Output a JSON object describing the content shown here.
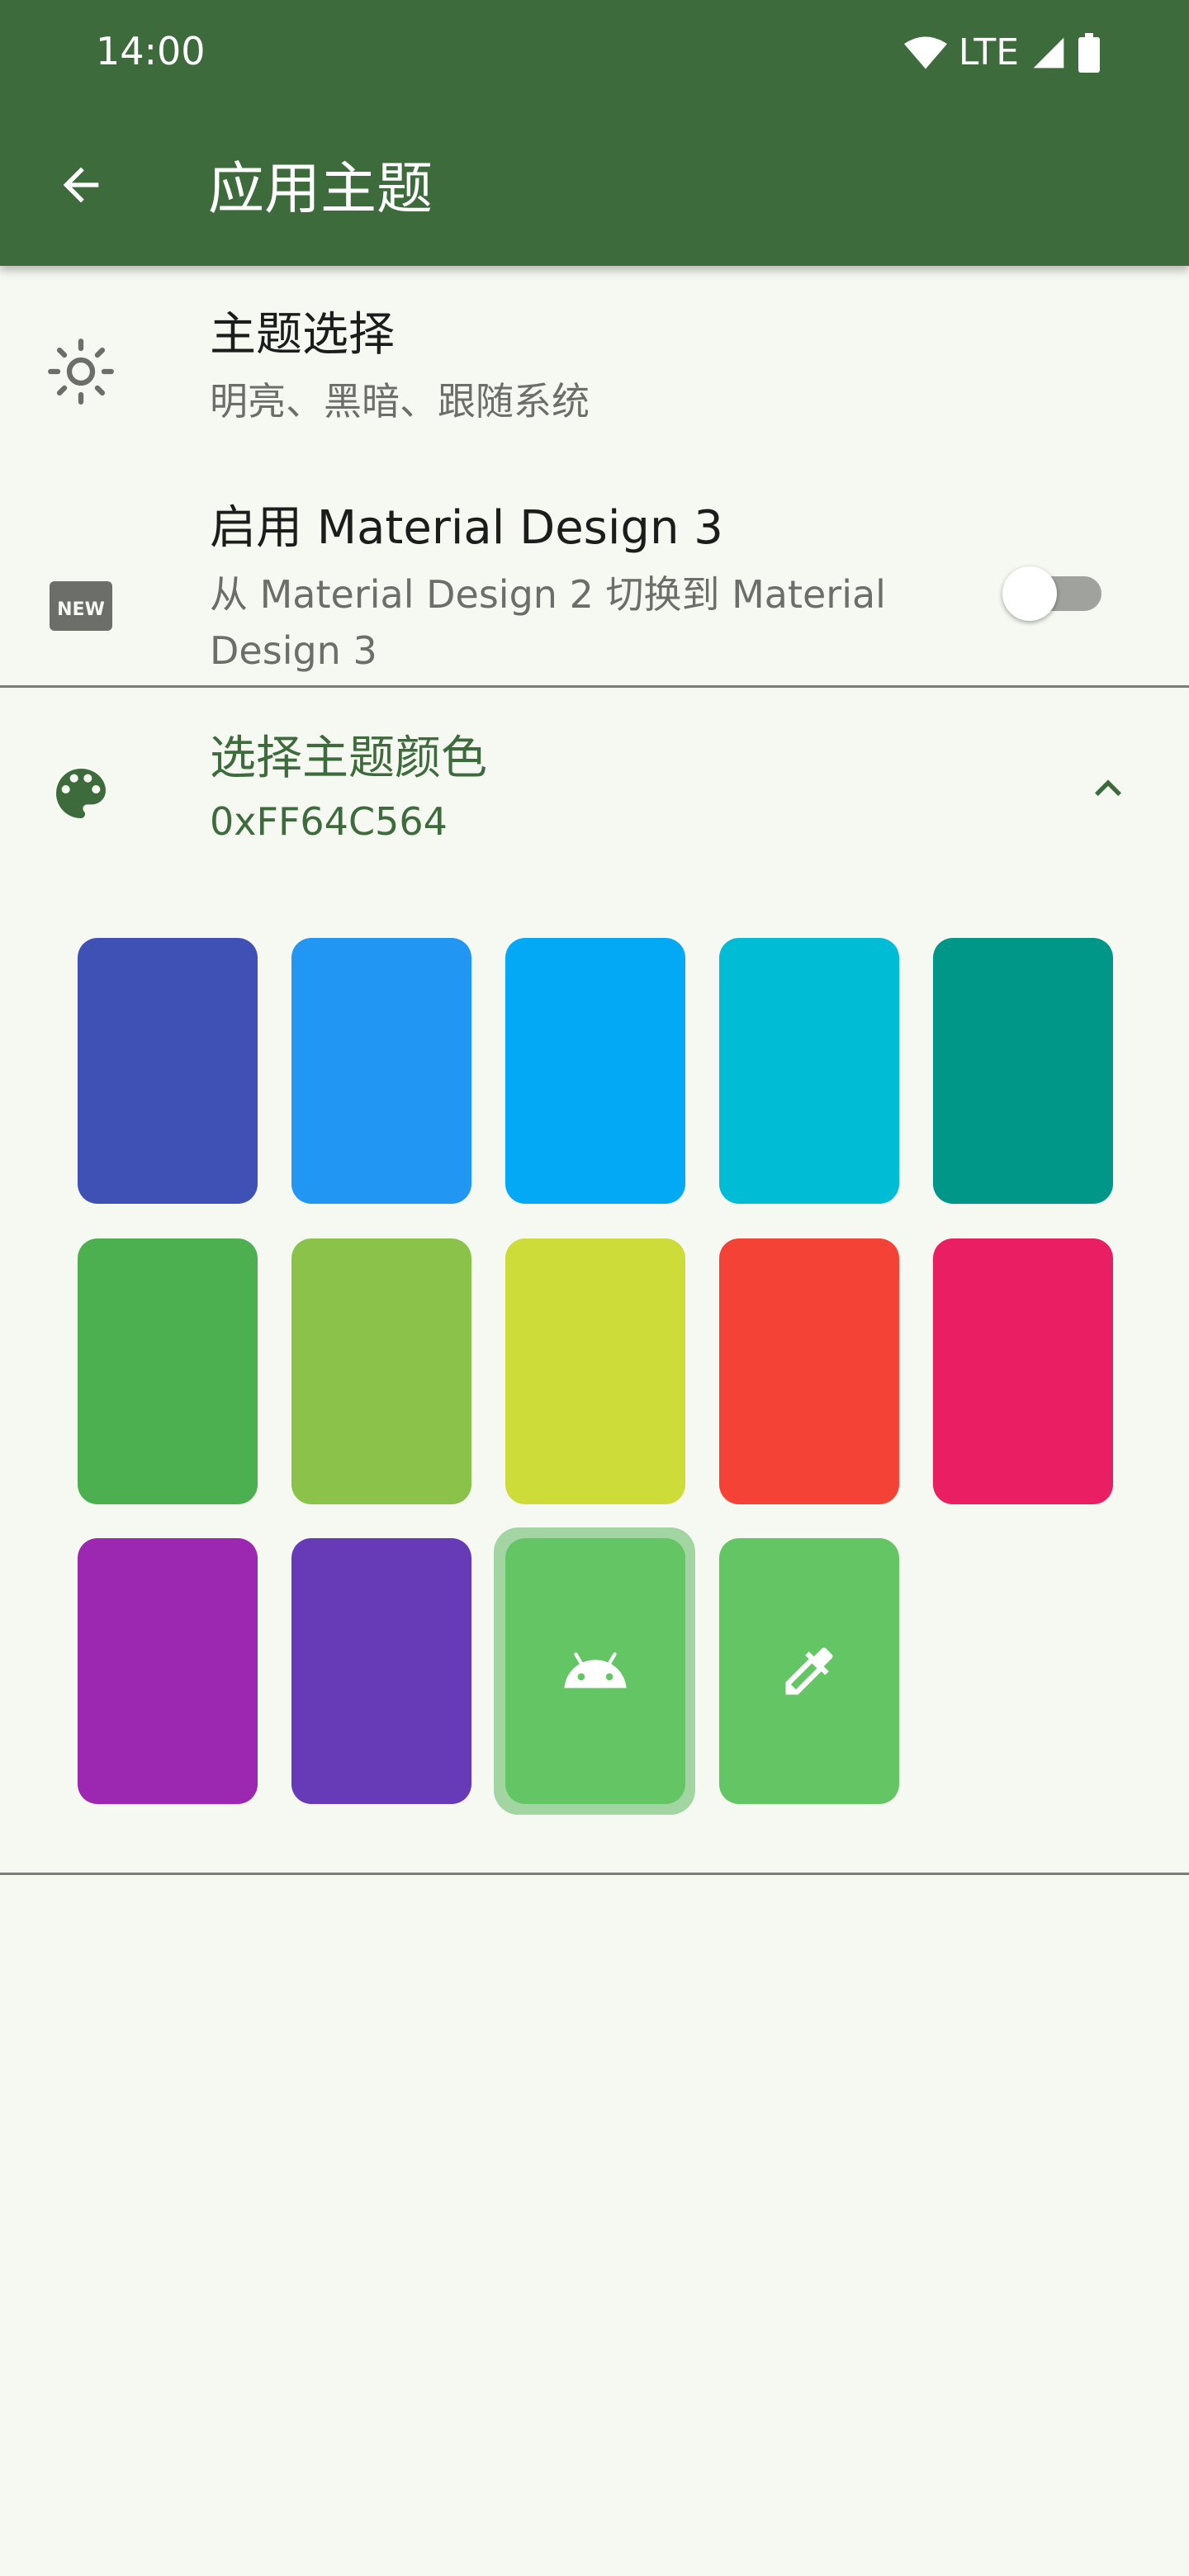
{
  "status_bar": {
    "time": "14:00",
    "network": "LTE",
    "icons": [
      "wifi-icon",
      "cell-signal-icon",
      "battery-icon"
    ]
  },
  "app_bar": {
    "title": "应用主题",
    "back_icon": "arrow-back-icon",
    "color": "#3d6b3c"
  },
  "settings": {
    "theme_mode": {
      "icon": "brightness-icon",
      "title": "主题选择",
      "subtitle": "明亮、黑暗、跟随系统"
    },
    "material3": {
      "icon": "new-badge-icon",
      "title": "启用 Material Design 3",
      "subtitle_line1": "从 Material Design 2 切换到 Material",
      "subtitle_line2": "Design 3",
      "enabled": false
    },
    "theme_color": {
      "icon": "palette-icon",
      "title": "选择主题颜色",
      "value": "0xFF64C564",
      "expanded": true,
      "expand_icon": "chevron-up-icon"
    }
  },
  "swatches": [
    {
      "color": "#3f51b5"
    },
    {
      "color": "#2196f3"
    },
    {
      "color": "#03a9f4"
    },
    {
      "color": "#00bcd4"
    },
    {
      "color": "#009688"
    },
    {
      "color": "#4caf50"
    },
    {
      "color": "#8bc34a"
    },
    {
      "color": "#cddc39"
    },
    {
      "color": "#f44336"
    },
    {
      "color": "#e91e63"
    },
    {
      "color": "#9c27b0"
    },
    {
      "color": "#673ab7"
    },
    {
      "color": "#64c564",
      "icon": "android-icon",
      "selected": true
    },
    {
      "color": "#64c564",
      "icon": "eyedropper-icon"
    }
  ]
}
